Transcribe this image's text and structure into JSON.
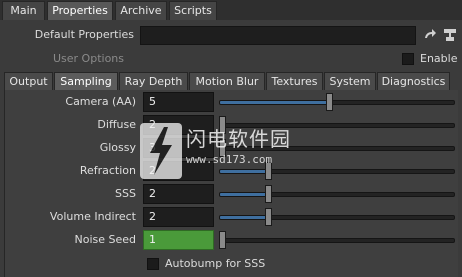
{
  "top_tabs": [
    "Main",
    "Properties",
    "Archive",
    "Scripts"
  ],
  "active_top_tab": "Properties",
  "default_properties": {
    "label": "Default Properties",
    "value": ""
  },
  "user_options": {
    "label": "User Options",
    "enable_label": "Enable"
  },
  "sub_tabs": [
    "Output",
    "Sampling",
    "Ray Depth",
    "Motion Blur",
    "Textures",
    "System",
    "Diagnostics"
  ],
  "active_sub_tab": "Sampling",
  "rows": [
    {
      "label": "Camera (AA)",
      "value": "5",
      "slider_fraction": 0.47
    },
    {
      "label": "Diffuse",
      "value": "2",
      "slider_fraction": 0.0
    },
    {
      "label": "Glossy",
      "value": "3",
      "slider_fraction": 0.0
    },
    {
      "label": "Refraction",
      "value": "2",
      "slider_fraction": 0.21
    },
    {
      "label": "SSS",
      "value": "2",
      "slider_fraction": 0.21
    },
    {
      "label": "Volume Indirect",
      "value": "2",
      "slider_fraction": 0.21
    },
    {
      "label": "Noise Seed",
      "value": "1",
      "slider_fraction": 0.0
    }
  ],
  "autobump_label": "Autobump for SSS",
  "watermark": {
    "title": "闪电软件园",
    "url": "www.sd173.com"
  },
  "colors": {
    "accent_fill": "#3f6f9f",
    "noise_seed_green": "#4a9a3a"
  }
}
